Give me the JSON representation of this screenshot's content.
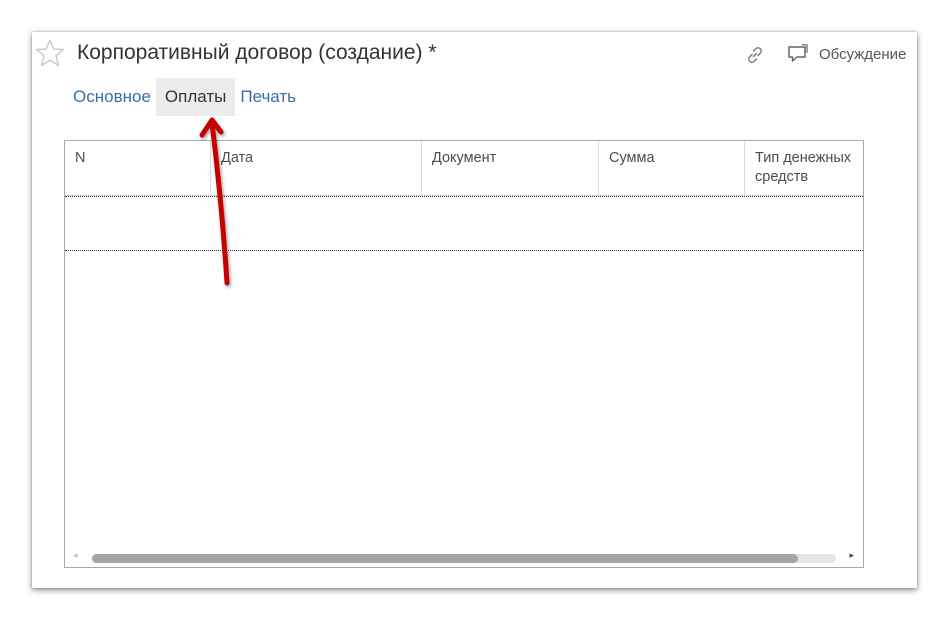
{
  "window": {
    "title": "Корпоративный договор (создание) *",
    "actions": {
      "discuss_label": "Обсуждение"
    }
  },
  "tabs": [
    {
      "label": "Основное",
      "active": false
    },
    {
      "label": "Оплаты",
      "active": true
    },
    {
      "label": "Печать",
      "active": false
    }
  ],
  "table": {
    "columns": [
      {
        "lines": [
          "N",
          ""
        ]
      },
      {
        "lines": [
          "Дата",
          ""
        ]
      },
      {
        "lines": [
          "Документ",
          ""
        ]
      },
      {
        "lines": [
          "Сумма",
          ""
        ]
      },
      {
        "lines": [
          "Тип денежных",
          "средств"
        ]
      }
    ],
    "rows": []
  },
  "scrollbar": {
    "left_arrow": "◂",
    "right_arrow": "▸"
  },
  "colors": {
    "tab_link": "#3b6ea8",
    "tab_active_bg": "#ececec",
    "annotation_arrow": "#c40000"
  },
  "icons": {
    "favorite": "star-icon",
    "link": "link-icon",
    "discuss": "chat-bubble-icon"
  }
}
